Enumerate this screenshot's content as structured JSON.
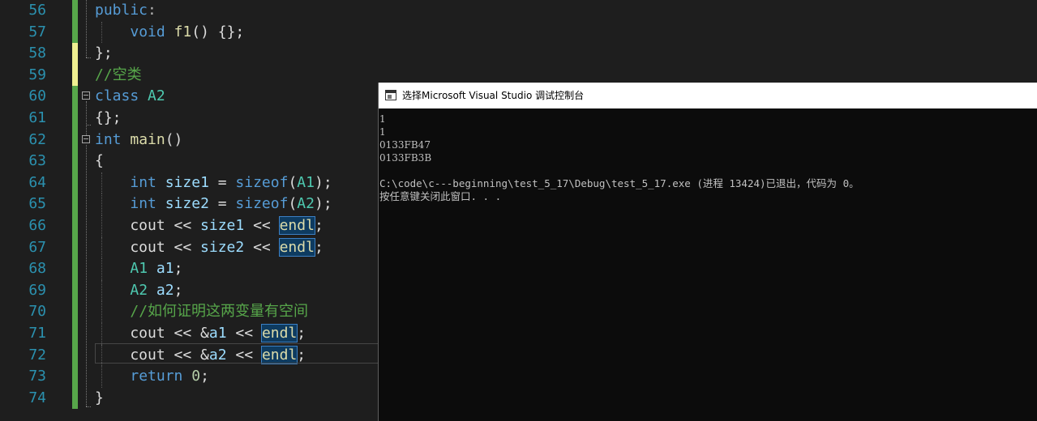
{
  "editor": {
    "lines": [
      {
        "num": "56",
        "tokens": [
          [
            "public",
            "kw"
          ],
          [
            ":",
            "op"
          ]
        ]
      },
      {
        "num": "57",
        "tokens": [
          [
            "    ",
            ""
          ],
          [
            "void",
            "kw"
          ],
          [
            " ",
            ""
          ],
          [
            "f1",
            "fn"
          ],
          [
            "() {};",
            ""
          ]
        ]
      },
      {
        "num": "58",
        "tokens": [
          [
            "};",
            ""
          ]
        ]
      },
      {
        "num": "59",
        "tokens": [
          [
            "//空类",
            "cm"
          ]
        ]
      },
      {
        "num": "60",
        "tokens": [
          [
            "class",
            "kw"
          ],
          [
            " ",
            ""
          ],
          [
            "A2",
            "ty"
          ]
        ]
      },
      {
        "num": "61",
        "tokens": [
          [
            "{};",
            ""
          ]
        ]
      },
      {
        "num": "62",
        "tokens": [
          [
            "int",
            "kw"
          ],
          [
            " ",
            ""
          ],
          [
            "main",
            "fn"
          ],
          [
            "()",
            ""
          ]
        ]
      },
      {
        "num": "63",
        "tokens": [
          [
            "{",
            ""
          ]
        ]
      },
      {
        "num": "64",
        "tokens": [
          [
            "    ",
            ""
          ],
          [
            "int",
            "kw"
          ],
          [
            " ",
            ""
          ],
          [
            "size1",
            "var"
          ],
          [
            " = ",
            ""
          ],
          [
            "sizeof",
            "kw"
          ],
          [
            "(",
            ""
          ],
          [
            "A1",
            "ty"
          ],
          [
            ");",
            ""
          ]
        ]
      },
      {
        "num": "65",
        "tokens": [
          [
            "    ",
            ""
          ],
          [
            "int",
            "kw"
          ],
          [
            " ",
            ""
          ],
          [
            "size2",
            "var"
          ],
          [
            " = ",
            ""
          ],
          [
            "sizeof",
            "kw"
          ],
          [
            "(",
            ""
          ],
          [
            "A2",
            "ty"
          ],
          [
            ");",
            ""
          ]
        ]
      },
      {
        "num": "66",
        "tokens": [
          [
            "    cout << ",
            ""
          ],
          [
            "size1",
            "var"
          ],
          [
            " << ",
            ""
          ],
          [
            "endl",
            "fn hl"
          ],
          [
            ";",
            ""
          ]
        ]
      },
      {
        "num": "67",
        "tokens": [
          [
            "    cout << ",
            ""
          ],
          [
            "size2",
            "var"
          ],
          [
            " << ",
            ""
          ],
          [
            "endl",
            "fn hl"
          ],
          [
            ";",
            ""
          ]
        ]
      },
      {
        "num": "68",
        "tokens": [
          [
            "    ",
            ""
          ],
          [
            "A1",
            "ty"
          ],
          [
            " ",
            ""
          ],
          [
            "a1",
            "var"
          ],
          [
            ";",
            ""
          ]
        ]
      },
      {
        "num": "69",
        "tokens": [
          [
            "    ",
            ""
          ],
          [
            "A2",
            "ty"
          ],
          [
            " ",
            ""
          ],
          [
            "a2",
            "var"
          ],
          [
            ";",
            ""
          ]
        ]
      },
      {
        "num": "70",
        "tokens": [
          [
            "    ",
            ""
          ],
          [
            "//如何证明这两变量有空间",
            "cm"
          ]
        ]
      },
      {
        "num": "71",
        "tokens": [
          [
            "    cout << &",
            ""
          ],
          [
            "a1",
            "var"
          ],
          [
            " << ",
            ""
          ],
          [
            "endl",
            "fn hl"
          ],
          [
            ";",
            ""
          ]
        ]
      },
      {
        "num": "72",
        "tokens": [
          [
            "    cout << &",
            ""
          ],
          [
            "a2",
            "var"
          ],
          [
            " << ",
            ""
          ],
          [
            "endl",
            "fn hl"
          ],
          [
            ";",
            ""
          ]
        ]
      },
      {
        "num": "73",
        "tokens": [
          [
            "    ",
            ""
          ],
          [
            "return",
            "kw"
          ],
          [
            " ",
            ""
          ],
          [
            "0",
            "num"
          ],
          [
            ";",
            ""
          ]
        ]
      },
      {
        "num": "74",
        "tokens": [
          [
            "}",
            ""
          ]
        ]
      }
    ]
  },
  "console": {
    "title": "选择Microsoft Visual Studio 调试控制台",
    "output": [
      "1",
      "1",
      "0133FB47",
      "0133FB3B",
      "",
      "C:\\code\\c---beginning\\test_5_17\\Debug\\test_5_17.exe (进程 13424)已退出，代码为 0。",
      "按任意键关闭此窗口. . ."
    ]
  }
}
